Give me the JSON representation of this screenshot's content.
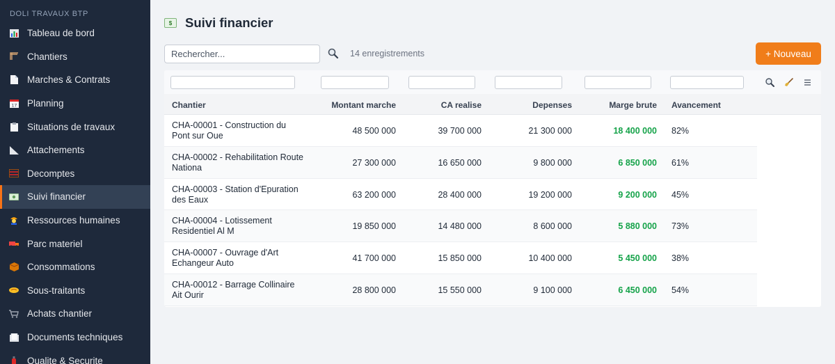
{
  "brand": "DOLI TRAVAUX BTP",
  "nav": [
    {
      "label": "Tableau de bord",
      "icon": "bar-chart-icon"
    },
    {
      "label": "Chantiers",
      "icon": "crane-icon"
    },
    {
      "label": "Marches & Contrats",
      "icon": "document-icon"
    },
    {
      "label": "Planning",
      "icon": "calendar-icon"
    },
    {
      "label": "Situations de travaux",
      "icon": "clipboard-icon"
    },
    {
      "label": "Attachements",
      "icon": "ruler-triangle-icon"
    },
    {
      "label": "Decomptes",
      "icon": "abacus-icon"
    },
    {
      "label": "Suivi financier",
      "icon": "banknote-icon"
    },
    {
      "label": "Ressources humaines",
      "icon": "worker-icon"
    },
    {
      "label": "Parc materiel",
      "icon": "truck-icon"
    },
    {
      "label": "Consommations",
      "icon": "box-icon"
    },
    {
      "label": "Sous-traitants",
      "icon": "handshake-icon"
    },
    {
      "label": "Achats chantier",
      "icon": "cart-icon"
    },
    {
      "label": "Documents techniques",
      "icon": "folder-icon"
    },
    {
      "label": "Qualite & Securite",
      "icon": "fire-extinguisher-icon"
    }
  ],
  "active_nav": "Suivi financier",
  "page": {
    "title": "Suivi financier",
    "title_icon": "banknote-icon",
    "search_placeholder": "Rechercher...",
    "count": "14 enregistrements",
    "new_button": "+ Nouveau"
  },
  "colors": {
    "accent": "#f07d1a",
    "sidebar": "#1e293b",
    "positive": "#16a34a"
  },
  "table": {
    "columns": [
      "Chantier",
      "Montant marche",
      "CA realise",
      "Depenses",
      "Marge brute",
      "Avancement"
    ],
    "rows": [
      {
        "chantier_l1": "CHA-00001 - Construction du",
        "chantier_l2": "Pont sur Oue",
        "montant": "48 500 000",
        "ca": "39 700 000",
        "depenses": "21 300 000",
        "marge": "18 400 000",
        "avancement": "82%"
      },
      {
        "chantier_l1": "CHA-00002 - Rehabilitation Route",
        "chantier_l2": "Nationa",
        "montant": "27 300 000",
        "ca": "16 650 000",
        "depenses": "9 800 000",
        "marge": "6 850 000",
        "avancement": "61%"
      },
      {
        "chantier_l1": "CHA-00003 - Station d'Epuration",
        "chantier_l2": "des Eaux",
        "montant": "63 200 000",
        "ca": "28 400 000",
        "depenses": "19 200 000",
        "marge": "9 200 000",
        "avancement": "45%"
      },
      {
        "chantier_l1": "CHA-00004 - Lotissement",
        "chantier_l2": "Residentiel Al M",
        "montant": "19 850 000",
        "ca": "14 480 000",
        "depenses": "8 600 000",
        "marge": "5 880 000",
        "avancement": "73%"
      },
      {
        "chantier_l1": "CHA-00007 - Ouvrage d'Art",
        "chantier_l2": "Echangeur Auto",
        "montant": "41 700 000",
        "ca": "15 850 000",
        "depenses": "10 400 000",
        "marge": "5 450 000",
        "avancement": "38%"
      },
      {
        "chantier_l1": "CHA-00012 - Barrage Collinaire",
        "chantier_l2": "Ait Ourir",
        "montant": "28 800 000",
        "ca": "15 550 000",
        "depenses": "9 100 000",
        "marge": "6 450 000",
        "avancement": "54%"
      }
    ]
  }
}
